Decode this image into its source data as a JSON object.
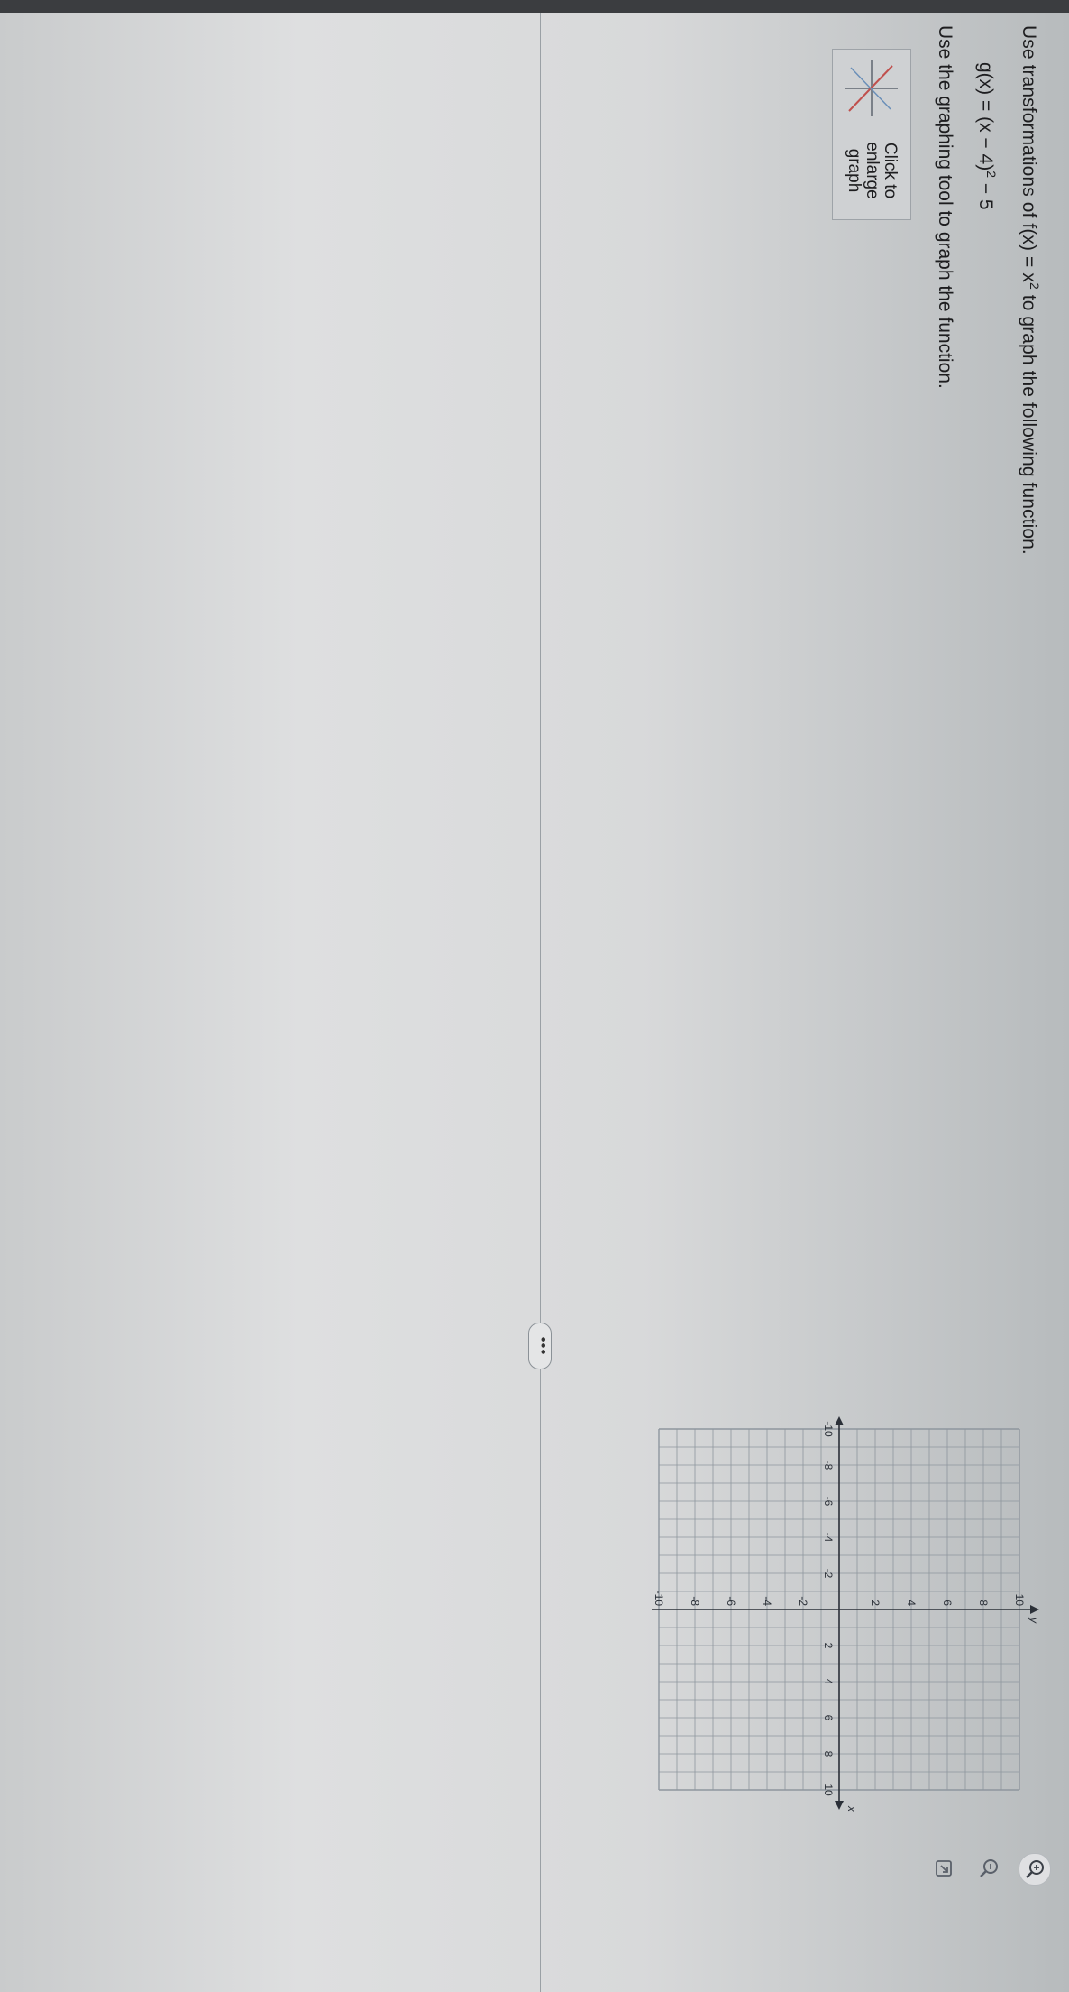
{
  "question": {
    "prefix": "Use transformations of f(x) = x",
    "exponent": "2",
    "suffix": " to graph the following function."
  },
  "function": {
    "prefix": "g(x) = (x − 4)",
    "exponent": "2",
    "suffix": " − 5"
  },
  "instruction": "Use the graphing tool to graph the function.",
  "thumbnail": {
    "label": "Click to enlarge graph"
  },
  "more_button": {
    "label": "•••"
  },
  "graph": {
    "x_axis_label": "x",
    "y_axis_label": "y",
    "x_range": [
      -10,
      10
    ],
    "y_range": [
      -10,
      10
    ],
    "grid_step": 1,
    "x_ticks": [
      "-10",
      "-8",
      "-6",
      "-4",
      "-2",
      "2",
      "4",
      "6",
      "8",
      "10"
    ],
    "y_ticks": [
      "10",
      "8",
      "6",
      "4",
      "2",
      "-2",
      "-4",
      "-6",
      "-8",
      "-10"
    ]
  },
  "tools": [
    "zoom-in-icon",
    "zoom-out-icon",
    "expand-icon"
  ]
}
